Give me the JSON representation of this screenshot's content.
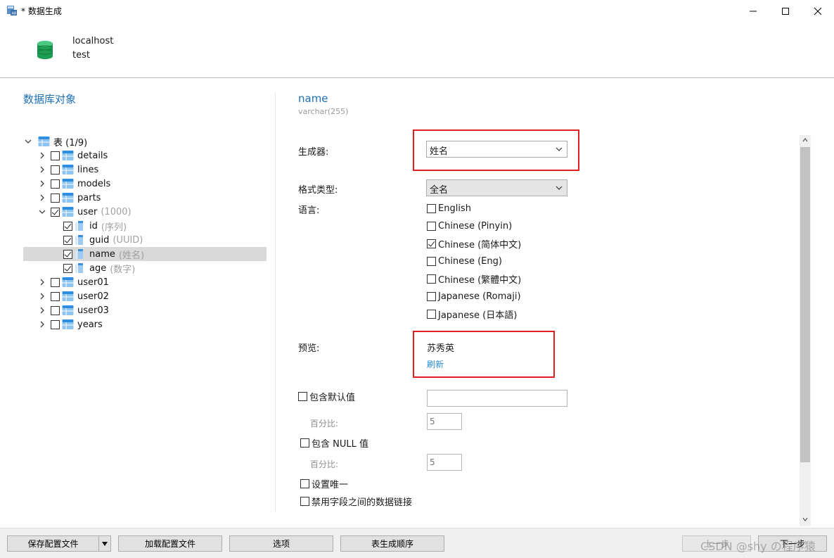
{
  "window": {
    "title": "* 数据生成",
    "minimize_icon": "minimize-icon",
    "maximize_icon": "maximize-icon",
    "close_icon": "close-icon"
  },
  "connection": {
    "host": "localhost",
    "database": "test",
    "icon": "database-icon"
  },
  "left_panel": {
    "title": "数据库对象",
    "tree_root": {
      "label": "表 (1/9)"
    },
    "tables": [
      {
        "label": "details",
        "checked": false
      },
      {
        "label": "lines",
        "checked": false
      },
      {
        "label": "models",
        "checked": false
      },
      {
        "label": "parts",
        "checked": false
      },
      {
        "label": "user",
        "sub": "(1000)",
        "checked": true,
        "expanded": true
      },
      {
        "label": "user01",
        "checked": false
      },
      {
        "label": "user02",
        "checked": false
      },
      {
        "label": "user03",
        "checked": false
      },
      {
        "label": "years",
        "checked": false
      }
    ],
    "columns": [
      {
        "label": "id",
        "sub": "(序列)",
        "checked": true
      },
      {
        "label": "guid",
        "sub": "(UUID)",
        "checked": true
      },
      {
        "label": "name",
        "sub": "(姓名)",
        "checked": true,
        "selected": true
      },
      {
        "label": "age",
        "sub": "(数字)",
        "checked": true
      }
    ]
  },
  "field": {
    "name": "name",
    "type": "varchar(255)"
  },
  "form": {
    "generator_label": "生成器:",
    "generator_value": "姓名",
    "format_label": "格式类型:",
    "format_value": "全名",
    "language_label": "语言:",
    "languages": [
      {
        "label": "English",
        "checked": false
      },
      {
        "label": "Chinese (Pinyin)",
        "checked": false
      },
      {
        "label": "Chinese (简体中文)",
        "checked": true
      },
      {
        "label": "Chinese (Eng)",
        "checked": false
      },
      {
        "label": "Chinese (繁體中文)",
        "checked": false
      },
      {
        "label": "Japanese (Romaji)",
        "checked": false
      },
      {
        "label": "Japanese (日本語)",
        "checked": false
      }
    ],
    "preview_label": "预览:",
    "preview_value": "苏秀英",
    "refresh_label": "刷新",
    "include_default_label": "包含默认值",
    "include_default_value": "",
    "percent_label_1": "百分比:",
    "percent_value_1": "5",
    "include_null_label": "包含 NULL 值",
    "percent_label_2": "百分比:",
    "percent_value_2": "5",
    "unique_label": "设置唯一",
    "disable_link_label": "禁用字段之间的数据链接"
  },
  "footer": {
    "save_config": "保存配置文件",
    "load_config": "加载配置文件",
    "options": "选项",
    "table_order": "表生成顺序",
    "prev": "上一步",
    "next": "下一步"
  },
  "watermark": "CSDN @shy の程序猿",
  "colors": {
    "accent": "#1d6fb8",
    "highlight_box": "#e02020",
    "link": "#2b8fd6",
    "selected_row": "#d9d9d9"
  }
}
